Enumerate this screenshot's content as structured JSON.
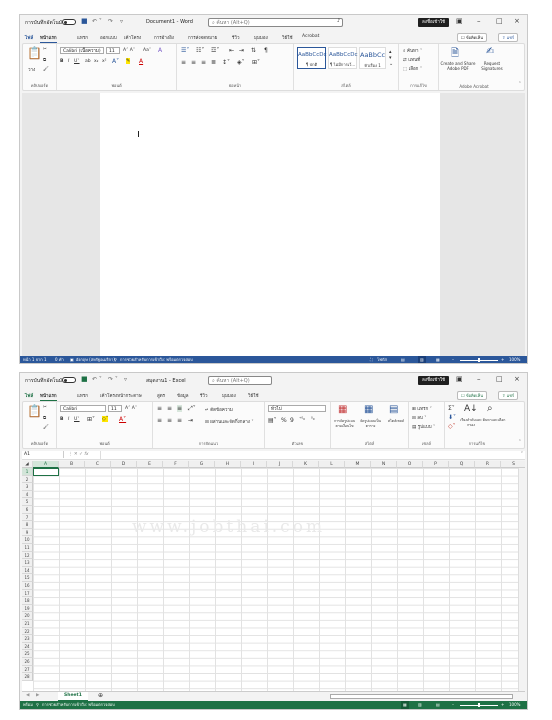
{
  "colors": {
    "word_accent": "#2b579a",
    "excel_accent": "#1e7145"
  },
  "word": {
    "autosave_label": "การบันทึกอัตโนมัติ",
    "title": "Document1 - Word",
    "search_placeholder": "ค้นหา (Alt+Q)",
    "account_button": "ลงชื่อเข้าใช้",
    "tabs": [
      "ไฟล์",
      "หน้าแรก",
      "แทรก",
      "ออกแบบ",
      "เค้าโครง",
      "การอ้างอิง",
      "การส่งจดหมาย",
      "รีวิว",
      "มุมมอง",
      "วิธีใช้",
      "Acrobat"
    ],
    "comments_button": "ข้อคิดเห็น",
    "share_button": "แชร์",
    "ribbon": {
      "paste_label": "วาง",
      "font_name": "Calibri (เนื้อความ)",
      "font_size": "11",
      "styles": [
        {
          "sample": "AaBbCcDc",
          "name": "¶ ปกติ"
        },
        {
          "sample": "AaBbCcDc",
          "name": "¶ ไม่มีการเว้..."
        },
        {
          "sample": "AaBbCc",
          "name": "หัวเรื่อง 1"
        }
      ],
      "find_label": "ค้นหา",
      "replace_label": "แทนที่",
      "select_label": "เลือก",
      "acrobat_create": "Create and Share Adobe PDF",
      "acrobat_request": "Request Signatures",
      "groups": [
        "คลิปบอร์ด",
        "ฟอนต์",
        "ย่อหน้า",
        "สไตล์",
        "การแก้ไข",
        "Adobe Acrobat"
      ]
    },
    "status": {
      "page": "หน้า 1 จาก 1",
      "words": "0 คำ",
      "language": "อังกฤษ (สหรัฐอเมริกา)",
      "accessibility": "การช่วยสำหรับการเข้าถึง: พร้อมตรวจสอบ",
      "focus": "โฟกัส",
      "zoom": "100%"
    }
  },
  "excel": {
    "autosave_label": "การบันทึกอัตโนมัติ",
    "title": "สมุดงาน1 - Excel",
    "search_placeholder": "ค้นหา (Alt+Q)",
    "account_button": "ลงชื่อเข้าใช้",
    "tabs": [
      "ไฟล์",
      "หน้าแรก",
      "แทรก",
      "เค้าโครงหน้ากระดาษ",
      "สูตร",
      "ข้อมูล",
      "รีวิว",
      "มุมมอง",
      "วิธีใช้"
    ],
    "comments_button": "ข้อคิดเห็น",
    "share_button": "แชร์",
    "ribbon": {
      "font_name": "Calibri",
      "font_size": "11",
      "wrap_text": "ตัดข้อความ",
      "merge_center": "ผสานและจัดกึ่งกลาง",
      "number_format": "ทั่วไป",
      "conditional_format": "การจัดรูปแบบตามเงื่อนไข",
      "format_as_table": "จัดรูปแบบเป็นตาราง",
      "cell_styles": "สไตล์เซลล์",
      "insert": "แทรก",
      "delete": "ลบ",
      "format": "รูปแบบ",
      "sort_filter": "เรียงลำดับและกรอง",
      "find_select": "ค้นหาและเลือก",
      "groups": [
        "คลิปบอร์ด",
        "ฟอนต์",
        "การจัดแนว",
        "ตัวเลข",
        "สไตล์",
        "เซลล์",
        "การแก้ไข"
      ]
    },
    "name_box": "A1",
    "columns": [
      "A",
      "B",
      "C",
      "D",
      "E",
      "F",
      "G",
      "H",
      "I",
      "J",
      "K",
      "L",
      "M",
      "N",
      "O",
      "P",
      "Q",
      "R",
      "S"
    ],
    "rows": [
      "1",
      "2",
      "3",
      "4",
      "5",
      "6",
      "7",
      "8",
      "9",
      "10",
      "11",
      "12",
      "13",
      "14",
      "15",
      "16",
      "17",
      "18",
      "19",
      "20",
      "21",
      "22",
      "23",
      "24",
      "25",
      "26",
      "27",
      "28"
    ],
    "sheet_tab": "Sheet1",
    "status": {
      "ready": "พร้อม",
      "accessibility": "การช่วยสำหรับการเข้าถึง: พร้อมตรวจสอบ",
      "zoom": "100%"
    },
    "watermark": "www.jobthai.com"
  }
}
